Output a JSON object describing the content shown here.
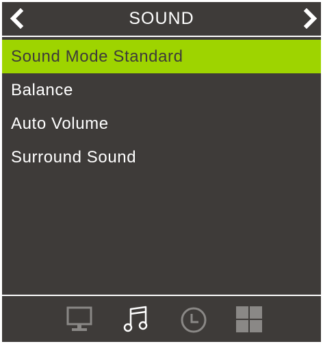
{
  "header": {
    "title": "SOUND",
    "prev_icon": "chevron-left-icon",
    "next_icon": "chevron-right-icon"
  },
  "menu": {
    "items": [
      {
        "label": "Sound Mode Standard",
        "selected": true
      },
      {
        "label": "Balance",
        "selected": false
      },
      {
        "label": "Auto Volume",
        "selected": false
      },
      {
        "label": "Surround Sound",
        "selected": false
      }
    ]
  },
  "footer": {
    "icons": [
      "monitor-icon",
      "music-note-icon",
      "clock-icon",
      "grid-icon"
    ]
  },
  "colors": {
    "background": "#3e3b39",
    "highlight": "#9ed400",
    "text": "#ffffff",
    "icon_dim": "#8a8886",
    "icon_active": "#ffffff"
  }
}
